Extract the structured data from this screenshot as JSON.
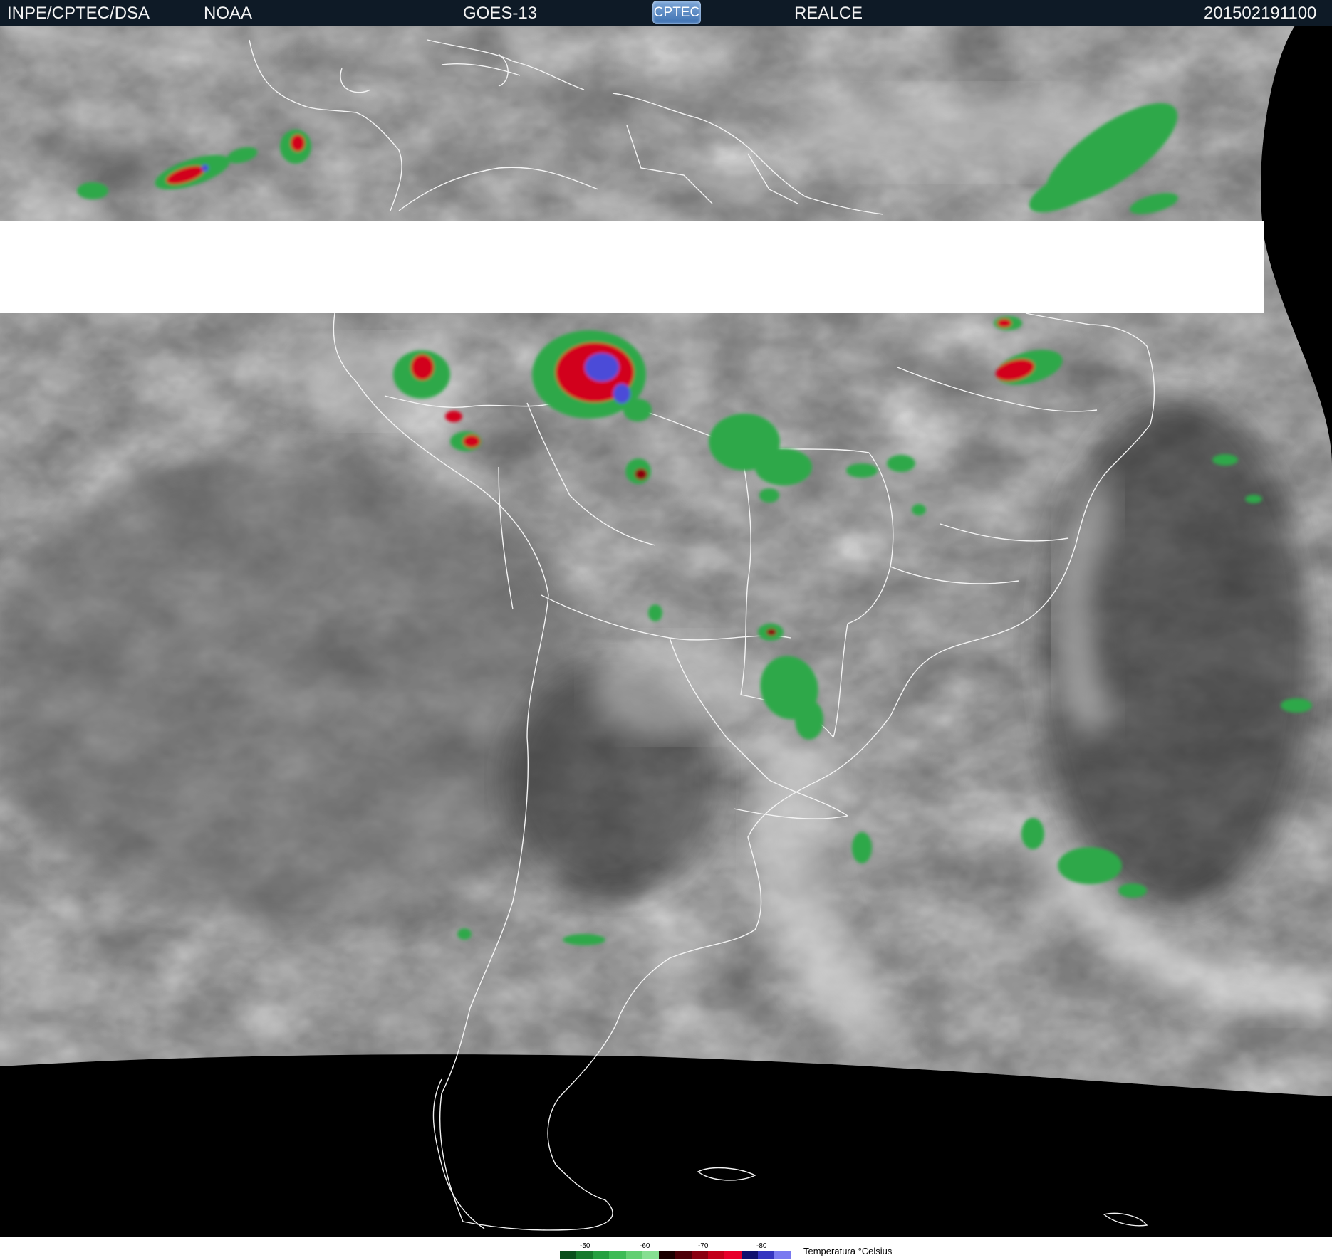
{
  "header": {
    "agency": "INPE/CPTEC/DSA",
    "provider": "NOAA",
    "satellite": "GOES-13",
    "logo_text": "CPTEC",
    "product": "REALCE",
    "timestamp": "201502191100"
  },
  "legend": {
    "title": "Temperatura °Celsius",
    "ticks": [
      "-50",
      "-60",
      "-70",
      "-80"
    ],
    "colors": [
      "#0a4f1c",
      "#167a2c",
      "#25a040",
      "#3dbb55",
      "#62cf72",
      "#86df92",
      "#1a0000",
      "#4d0008",
      "#8a0010",
      "#c2001a",
      "#e8002a",
      "#11116e",
      "#3535c0",
      "#7a7af0"
    ]
  },
  "map": {
    "region": "South America",
    "colors": {
      "ocean_dark": "#3a3a3a",
      "ocean_mid": "#555555",
      "cloud_white": "#d8d8d8",
      "no_data": "#000000",
      "missing_scan": "#ffffff",
      "borders": "#f4f4f4",
      "cold_green": "#2fa84a",
      "very_cold_red": "#d2001e",
      "coldest_blue": "#4b4bd8"
    }
  }
}
